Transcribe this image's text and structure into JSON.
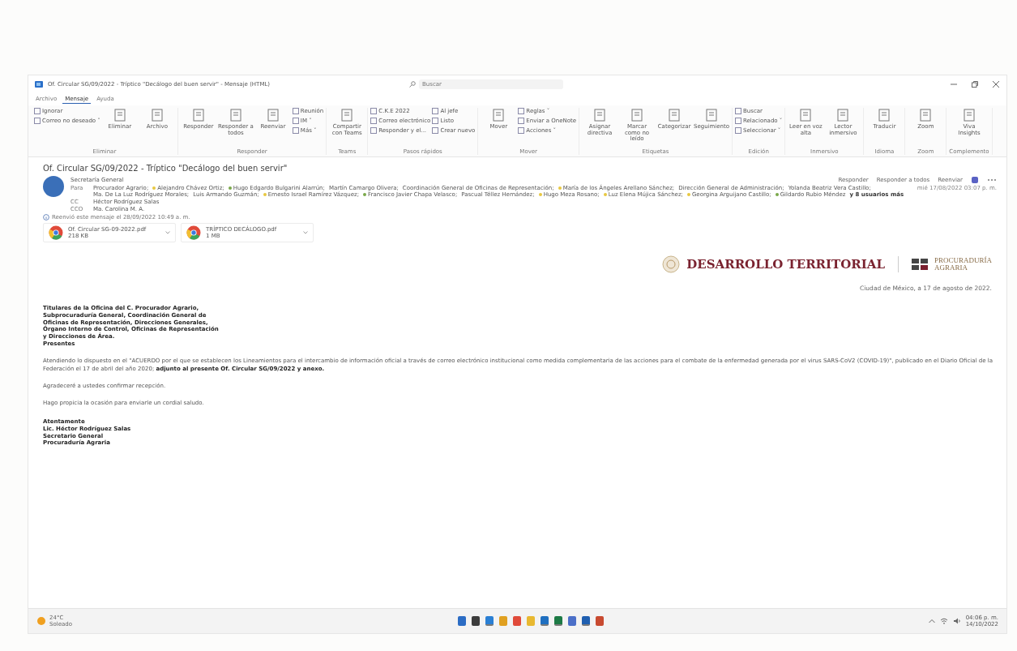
{
  "window": {
    "title": "Of. Circular SG/09/2022 - Tríptico \"Decálogo del buen servir\" - Mensaje (HTML)",
    "search_placeholder": "Buscar"
  },
  "menu_tabs": [
    {
      "label": "Archivo",
      "selected": false
    },
    {
      "label": "Mensaje",
      "selected": true
    },
    {
      "label": "Ayuda",
      "selected": false
    }
  ],
  "ribbon": [
    {
      "label": "Eliminar",
      "buttons": [
        {
          "label": "Ignorar",
          "kind": "small"
        },
        {
          "label": "Correo no deseado ˅",
          "kind": "small"
        },
        {
          "label": "Eliminar",
          "kind": "large"
        },
        {
          "label": "Archivo",
          "kind": "large"
        }
      ]
    },
    {
      "label": "Responder",
      "buttons": [
        {
          "label": "Responder",
          "kind": "large"
        },
        {
          "label": "Responder a todos",
          "kind": "large"
        },
        {
          "label": "Reenviar",
          "kind": "large"
        },
        {
          "label": "Reunión",
          "kind": "small"
        },
        {
          "label": "IM ˅",
          "kind": "small"
        },
        {
          "label": "Más ˅",
          "kind": "small"
        }
      ]
    },
    {
      "label": "Teams",
      "buttons": [
        {
          "label": "Compartir con Teams",
          "kind": "large"
        }
      ]
    },
    {
      "label": "Pasos rápidos",
      "buttons": [
        {
          "label": "C.K.E 2022",
          "kind": "small"
        },
        {
          "label": "Correo electrónico",
          "kind": "small"
        },
        {
          "label": "Responder y el...",
          "kind": "small"
        },
        {
          "label": "Al jefe",
          "kind": "small"
        },
        {
          "label": "Listo",
          "kind": "small"
        },
        {
          "label": "Crear nuevo",
          "kind": "small"
        }
      ]
    },
    {
      "label": "Mover",
      "buttons": [
        {
          "label": "Mover",
          "kind": "large"
        },
        {
          "label": "Reglas ˅",
          "kind": "small"
        },
        {
          "label": "Enviar a OneNote",
          "kind": "small"
        },
        {
          "label": "Acciones ˅",
          "kind": "small"
        }
      ]
    },
    {
      "label": "Etiquetas",
      "buttons": [
        {
          "label": "Asignar directiva",
          "kind": "large"
        },
        {
          "label": "Marcar como no leído",
          "kind": "large"
        },
        {
          "label": "Categorizar",
          "kind": "large"
        },
        {
          "label": "Seguimiento",
          "kind": "large"
        }
      ]
    },
    {
      "label": "Edición",
      "buttons": [
        {
          "label": "Buscar",
          "kind": "small"
        },
        {
          "label": "Relacionado ˅",
          "kind": "small"
        },
        {
          "label": "Seleccionar ˅",
          "kind": "small"
        }
      ]
    },
    {
      "label": "Inmersivo",
      "buttons": [
        {
          "label": "Leer en voz alta",
          "kind": "large"
        },
        {
          "label": "Lector inmersivo",
          "kind": "large"
        }
      ]
    },
    {
      "label": "Idioma",
      "buttons": [
        {
          "label": "Traducir",
          "kind": "large"
        }
      ]
    },
    {
      "label": "Zoom",
      "buttons": [
        {
          "label": "Zoom",
          "kind": "large"
        }
      ]
    },
    {
      "label": "Complemento",
      "buttons": [
        {
          "label": "Viva Insights",
          "kind": "large"
        }
      ]
    }
  ],
  "message": {
    "subject": "Of. Circular SG/09/2022 - Tríptico \"Decálogo del buen servir\"",
    "sender": "Secretaría General",
    "actions": [
      {
        "label": "Responder"
      },
      {
        "label": "Responder a todos"
      },
      {
        "label": "Reenviar"
      }
    ],
    "date": "mié 17/08/2022 03:07 p. m.",
    "to_label": "Para",
    "to": [
      {
        "name": "Procurador Agrario;"
      },
      {
        "name": "Alejandro Chávez Ortiz;",
        "color": "#e8c840"
      },
      {
        "name": "Hugo Edgardo Bulgarini Alarrún;",
        "color": "#7aa84a"
      },
      {
        "name": "Martín Camargo Olivera;"
      },
      {
        "name": "Coordinación General de Oficinas de Representación;"
      },
      {
        "name": "María de los Ángeles Arellano Sánchez;",
        "color": "#e8c840"
      },
      {
        "name": "Dirección General de Administración;"
      },
      {
        "name": "Yolanda Beatriz Vera Castillo;"
      },
      {
        "name": "Ma. De La Luz Rodríguez Morales;"
      },
      {
        "name": "Luis Armando Guzmán;"
      },
      {
        "name": "Ernesto Israel Ramírez Vázquez;",
        "color": "#e8c840"
      },
      {
        "name": "Francisco Javier Chapa Velasco;",
        "color": "#7aa84a"
      },
      {
        "name": "Pascual Téllez Hernández;"
      },
      {
        "name": "Hugo Meza Rosano;",
        "color": "#e8c840"
      },
      {
        "name": "Luz Elena Mújica Sánchez;",
        "color": "#e8c840"
      },
      {
        "name": "Georgina Arguijano Castillo;",
        "color": "#e8c840"
      },
      {
        "name": "Gildardo Rubio Méndez",
        "color": "#7aa84a"
      }
    ],
    "more": "y 8 usuarios más",
    "cc_label": "CC",
    "cc": "Héctor Rodríguez Salas",
    "bcc_label": "CCO",
    "bcc": "Ma. Carolina M. A.",
    "info": "Reenvió este mensaje el 28/09/2022 10:49 a. m.",
    "attachments": [
      {
        "name": "Of. Circular SG-09-2022.pdf",
        "size": "218 KB"
      },
      {
        "name": "TRÍPTICO DECÁLOGO.pdf",
        "size": "1 MB"
      }
    ]
  },
  "letter": {
    "brand": "DESARROLLO TERRITORIAL",
    "agency_line1": "PROCURADURÍA",
    "agency_line2": "AGRARIA",
    "place_date": "Ciudad de México, a 17 de agosto de 2022.",
    "recipients": [
      "Titulares de la Oficina del C. Procurador Agrario,",
      "Subprocuraduría General, Coordinación General de",
      "Oficinas de Representación, Direcciones Generales,",
      "Órgano Interno de Control, Oficinas de Representación",
      "y Direcciones de Área.",
      "Presentes"
    ],
    "paragraphs": [
      "Atendiendo lo dispuesto en el \"ACUERDO por el que se establecen los Lineamientos para el intercambio de información oficial a través de correo electrónico institucional como medida complementaria de las acciones para el combate de la enfermedad generada por el virus SARS-CoV2 (COVID-19)\", publicado en el Diario Oficial de la Federación el 17 de abril del año 2020; **adjunto al presente Of. Circular SG/09/2022 y anexo.**",
      "Agradeceré a ustedes confirmar recepción.",
      "Hago propicia la ocasión para enviarle un cordial saludo."
    ],
    "signature": [
      "Atentamente",
      "Lic. Héctor Rodríguez Salas",
      "Secretario General",
      "Procuraduría Agraria"
    ]
  },
  "taskbar": {
    "temperature": "24°C",
    "weather": "Soleado",
    "apps": [
      {
        "color": "#2b6cc4",
        "running": false
      },
      {
        "color": "#3c3c3c",
        "running": false
      },
      {
        "color": "#2a7fd4",
        "running": true
      },
      {
        "color": "#e0a020",
        "running": false
      },
      {
        "color": "#e04a3a",
        "running": false
      },
      {
        "color": "#e8b830",
        "running": false
      },
      {
        "color": "#1f6fc0",
        "running": true
      },
      {
        "color": "#1d7a45",
        "running": true
      },
      {
        "color": "#4b6fc8",
        "running": false
      },
      {
        "color": "#1f5fb0",
        "running": true
      },
      {
        "color": "#c84a30",
        "running": false
      }
    ],
    "time": "04:06 p. m.",
    "date": "14/10/2022"
  }
}
